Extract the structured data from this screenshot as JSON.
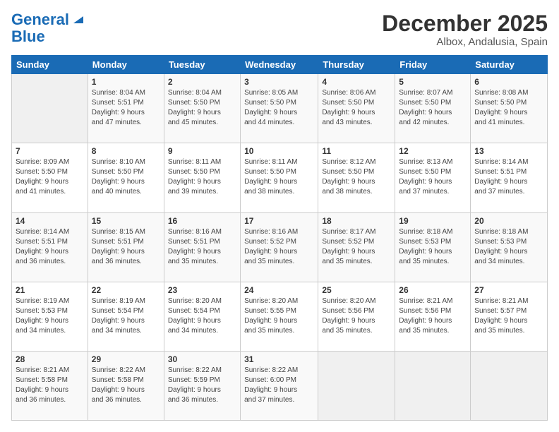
{
  "header": {
    "logo_line1": "General",
    "logo_line2": "Blue",
    "month": "December 2025",
    "location": "Albox, Andalusia, Spain"
  },
  "days_of_week": [
    "Sunday",
    "Monday",
    "Tuesday",
    "Wednesday",
    "Thursday",
    "Friday",
    "Saturday"
  ],
  "weeks": [
    [
      {
        "num": "",
        "info": ""
      },
      {
        "num": "1",
        "info": "Sunrise: 8:04 AM\nSunset: 5:51 PM\nDaylight: 9 hours\nand 47 minutes."
      },
      {
        "num": "2",
        "info": "Sunrise: 8:04 AM\nSunset: 5:50 PM\nDaylight: 9 hours\nand 45 minutes."
      },
      {
        "num": "3",
        "info": "Sunrise: 8:05 AM\nSunset: 5:50 PM\nDaylight: 9 hours\nand 44 minutes."
      },
      {
        "num": "4",
        "info": "Sunrise: 8:06 AM\nSunset: 5:50 PM\nDaylight: 9 hours\nand 43 minutes."
      },
      {
        "num": "5",
        "info": "Sunrise: 8:07 AM\nSunset: 5:50 PM\nDaylight: 9 hours\nand 42 minutes."
      },
      {
        "num": "6",
        "info": "Sunrise: 8:08 AM\nSunset: 5:50 PM\nDaylight: 9 hours\nand 41 minutes."
      }
    ],
    [
      {
        "num": "7",
        "info": "Sunrise: 8:09 AM\nSunset: 5:50 PM\nDaylight: 9 hours\nand 41 minutes."
      },
      {
        "num": "8",
        "info": "Sunrise: 8:10 AM\nSunset: 5:50 PM\nDaylight: 9 hours\nand 40 minutes."
      },
      {
        "num": "9",
        "info": "Sunrise: 8:11 AM\nSunset: 5:50 PM\nDaylight: 9 hours\nand 39 minutes."
      },
      {
        "num": "10",
        "info": "Sunrise: 8:11 AM\nSunset: 5:50 PM\nDaylight: 9 hours\nand 38 minutes."
      },
      {
        "num": "11",
        "info": "Sunrise: 8:12 AM\nSunset: 5:50 PM\nDaylight: 9 hours\nand 38 minutes."
      },
      {
        "num": "12",
        "info": "Sunrise: 8:13 AM\nSunset: 5:50 PM\nDaylight: 9 hours\nand 37 minutes."
      },
      {
        "num": "13",
        "info": "Sunrise: 8:14 AM\nSunset: 5:51 PM\nDaylight: 9 hours\nand 37 minutes."
      }
    ],
    [
      {
        "num": "14",
        "info": "Sunrise: 8:14 AM\nSunset: 5:51 PM\nDaylight: 9 hours\nand 36 minutes."
      },
      {
        "num": "15",
        "info": "Sunrise: 8:15 AM\nSunset: 5:51 PM\nDaylight: 9 hours\nand 36 minutes."
      },
      {
        "num": "16",
        "info": "Sunrise: 8:16 AM\nSunset: 5:51 PM\nDaylight: 9 hours\nand 35 minutes."
      },
      {
        "num": "17",
        "info": "Sunrise: 8:16 AM\nSunset: 5:52 PM\nDaylight: 9 hours\nand 35 minutes."
      },
      {
        "num": "18",
        "info": "Sunrise: 8:17 AM\nSunset: 5:52 PM\nDaylight: 9 hours\nand 35 minutes."
      },
      {
        "num": "19",
        "info": "Sunrise: 8:18 AM\nSunset: 5:53 PM\nDaylight: 9 hours\nand 35 minutes."
      },
      {
        "num": "20",
        "info": "Sunrise: 8:18 AM\nSunset: 5:53 PM\nDaylight: 9 hours\nand 34 minutes."
      }
    ],
    [
      {
        "num": "21",
        "info": "Sunrise: 8:19 AM\nSunset: 5:53 PM\nDaylight: 9 hours\nand 34 minutes."
      },
      {
        "num": "22",
        "info": "Sunrise: 8:19 AM\nSunset: 5:54 PM\nDaylight: 9 hours\nand 34 minutes."
      },
      {
        "num": "23",
        "info": "Sunrise: 8:20 AM\nSunset: 5:54 PM\nDaylight: 9 hours\nand 34 minutes."
      },
      {
        "num": "24",
        "info": "Sunrise: 8:20 AM\nSunset: 5:55 PM\nDaylight: 9 hours\nand 35 minutes."
      },
      {
        "num": "25",
        "info": "Sunrise: 8:20 AM\nSunset: 5:56 PM\nDaylight: 9 hours\nand 35 minutes."
      },
      {
        "num": "26",
        "info": "Sunrise: 8:21 AM\nSunset: 5:56 PM\nDaylight: 9 hours\nand 35 minutes."
      },
      {
        "num": "27",
        "info": "Sunrise: 8:21 AM\nSunset: 5:57 PM\nDaylight: 9 hours\nand 35 minutes."
      }
    ],
    [
      {
        "num": "28",
        "info": "Sunrise: 8:21 AM\nSunset: 5:58 PM\nDaylight: 9 hours\nand 36 minutes."
      },
      {
        "num": "29",
        "info": "Sunrise: 8:22 AM\nSunset: 5:58 PM\nDaylight: 9 hours\nand 36 minutes."
      },
      {
        "num": "30",
        "info": "Sunrise: 8:22 AM\nSunset: 5:59 PM\nDaylight: 9 hours\nand 36 minutes."
      },
      {
        "num": "31",
        "info": "Sunrise: 8:22 AM\nSunset: 6:00 PM\nDaylight: 9 hours\nand 37 minutes."
      },
      {
        "num": "",
        "info": ""
      },
      {
        "num": "",
        "info": ""
      },
      {
        "num": "",
        "info": ""
      }
    ]
  ]
}
